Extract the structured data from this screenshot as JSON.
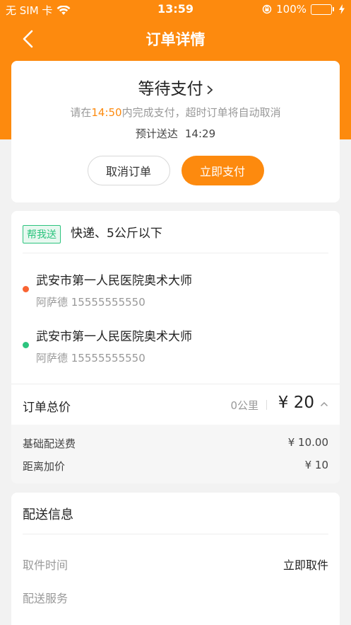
{
  "status_bar": {
    "carrier": "无 SIM 卡",
    "time": "13:59",
    "battery": "100%",
    "battery_color": "#4cd964"
  },
  "nav": {
    "title": "订单详情",
    "back_icon": "chevron-left-icon"
  },
  "status_card": {
    "heading": "等待支付",
    "deadline_prefix": "请在",
    "deadline_time": "14:50",
    "deadline_suffix": "内完成支付，超时订单将自动取消",
    "eta_label": "预计送达",
    "eta_time": "14:29",
    "cancel_label": "取消订单",
    "pay_label": "立即支付"
  },
  "order": {
    "service_tag": "帮我送",
    "service_type": "快递、5公斤以下",
    "pickup": {
      "name": "武安市第一人民医院奥术大师",
      "contact": "阿萨德 15555555550"
    },
    "dropoff": {
      "name": "武安市第一人民医院奥术大师",
      "contact": "阿萨德 15555555550"
    },
    "total_label": "订单总价",
    "distance": "0公里",
    "total_price": "¥ 20",
    "breakdown": [
      {
        "label": "基础配送费",
        "value": "¥ 10.00"
      },
      {
        "label": "距离加价",
        "value": "¥ 10"
      }
    ]
  },
  "delivery": {
    "title": "配送信息",
    "rows": [
      {
        "label": "取件时间",
        "value": "立即取件"
      },
      {
        "label": "配送服务",
        "value": ""
      }
    ]
  },
  "colors": {
    "accent": "#fd8a0e",
    "tag_green": "#2cc47e",
    "pickup_dot": "#f96433",
    "dropoff_dot": "#2cc47e"
  }
}
